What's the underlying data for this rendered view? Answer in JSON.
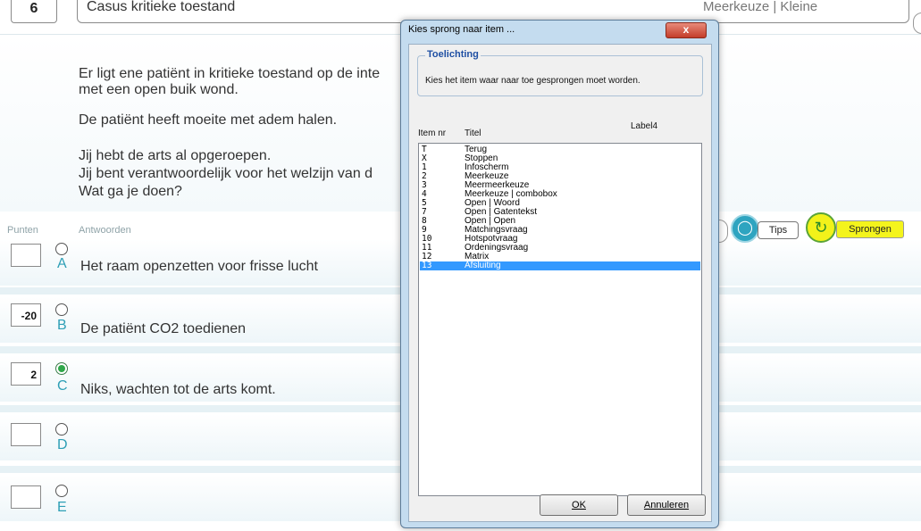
{
  "header": {
    "item_no": "6",
    "title": "Casus kritieke toestand",
    "type": "Meerkeuze | Kleine"
  },
  "case_lines": [
    "Er ligt ene patiënt in kritieke toestand op de inte",
    "met een open buik wond.",
    "De patiënt heeft moeite met adem halen.",
    "Jij hebt de arts al opgeroepen.",
    "Jij bent verantwoordelijk voor het welzijn van d",
    "Wat ga je doen?"
  ],
  "labels": {
    "punten": "Punten",
    "antwoorden": "Antwoorden"
  },
  "answers": [
    {
      "letter": "A",
      "points": "",
      "text": "Het raam openzetten voor frisse lucht",
      "selected": false
    },
    {
      "letter": "B",
      "points": "-20",
      "text": "De patiënt CO2 toedienen",
      "selected": false
    },
    {
      "letter": "C",
      "points": "2",
      "text": "Niks, wachten tot de arts komt.",
      "selected": true
    },
    {
      "letter": "D",
      "points": "",
      "text": "",
      "selected": false
    },
    {
      "letter": "E",
      "points": "",
      "text": "",
      "selected": false
    }
  ],
  "buttons": {
    "tips": "Tips",
    "sprongen": "Sprongen"
  },
  "dialog": {
    "title": "Kies sprong naar item ...",
    "close": "x",
    "group_title": "Toelichting",
    "group_text": "Kies het item waar naar toe gesprongen moet worden.",
    "col_item": "Item nr",
    "col_titel": "Titel",
    "label4": "Label4",
    "items": [
      {
        "nr": "T",
        "title": "Terug"
      },
      {
        "nr": "X",
        "title": "Stoppen"
      },
      {
        "nr": "1",
        "title": "Infoscherm"
      },
      {
        "nr": "2",
        "title": "Meerkeuze"
      },
      {
        "nr": "3",
        "title": "Meermeerkeuze"
      },
      {
        "nr": "4",
        "title": "Meerkeuze | combobox"
      },
      {
        "nr": "5",
        "title": "Open | Woord"
      },
      {
        "nr": "7",
        "title": "Open | Gatentekst"
      },
      {
        "nr": "8",
        "title": "Open | Open"
      },
      {
        "nr": "9",
        "title": "Matchingsvraag"
      },
      {
        "nr": "10",
        "title": "Hotspotvraag"
      },
      {
        "nr": "11",
        "title": "Ordeningsvraag"
      },
      {
        "nr": "12",
        "title": "Matrix"
      },
      {
        "nr": "13",
        "title": "Afsluiting"
      }
    ],
    "selected_index": 13,
    "ok": "OK",
    "cancel": "Annuleren"
  },
  "colors": {
    "selection": "#3399ff",
    "accent": "#2e9fb6",
    "sprongen": "#f4f41c"
  }
}
